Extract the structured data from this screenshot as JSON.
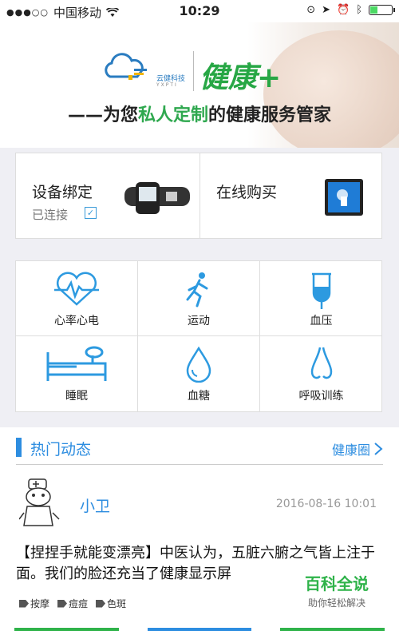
{
  "status_bar": {
    "carrier": "中国移动",
    "time": "10:29"
  },
  "banner": {
    "logo_cn": "云健科技",
    "logo_en": "YXPTI",
    "brand": "健康",
    "brand_plus": "+",
    "slogan_prefix": "——为您",
    "slogan_highlight": "私人定制",
    "slogan_suffix": "的健康服务管家"
  },
  "devices": {
    "bind_title": "设备绑定",
    "bind_status": "已连接",
    "buy_title": "在线购买"
  },
  "functions": [
    {
      "label": "心率心电",
      "icon": "heart-rate-icon"
    },
    {
      "label": "运动",
      "icon": "running-icon"
    },
    {
      "label": "血压",
      "icon": "blood-pressure-icon"
    },
    {
      "label": "睡眠",
      "icon": "bed-icon"
    },
    {
      "label": "血糖",
      "icon": "drop-icon"
    },
    {
      "label": "呼吸训练",
      "icon": "nose-icon"
    }
  ],
  "hot": {
    "title": "热门动态",
    "more": "健康圈",
    "post": {
      "user": "小卫",
      "date": "2016-08-16 10:01",
      "content": "【捏捏手就能变漂亮】中医认为，五脏六腑之气皆上注于面。我们的脸还充当了健康显示屏",
      "tags": [
        "按摩",
        "痘痘",
        "色斑"
      ]
    }
  },
  "watermark": {
    "title": "百科全说",
    "subtitle": "助你轻松解决"
  },
  "colors": {
    "accent": "#2d8de0",
    "green": "#2fa84f"
  }
}
